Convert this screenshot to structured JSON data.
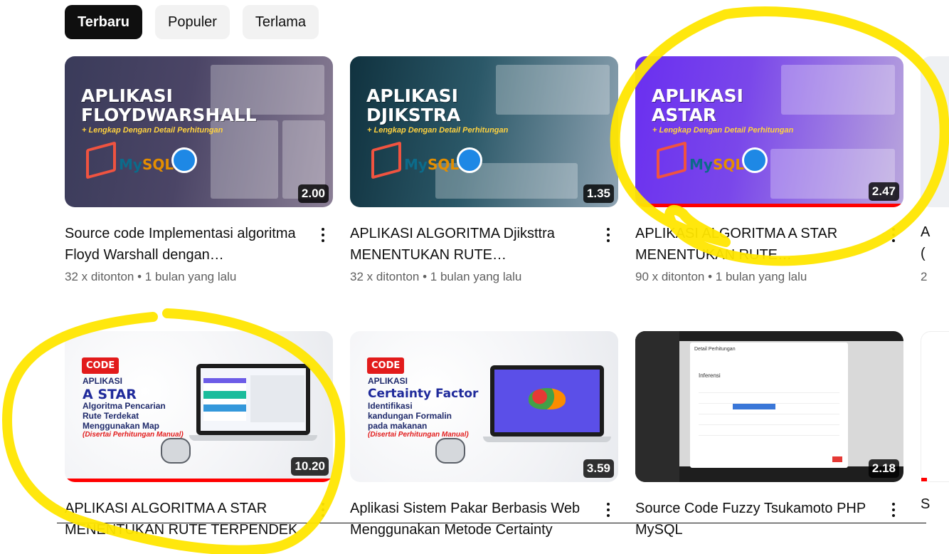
{
  "chips": [
    {
      "label": "Terbaru",
      "active": true
    },
    {
      "label": "Populer",
      "active": false
    },
    {
      "label": "Terlama",
      "active": false
    }
  ],
  "videos": [
    {
      "title": "Source code Implementasi algoritma Floyd Warshall dengan…",
      "views": "32 x ditonton",
      "age": "1 bulan yang lalu",
      "duration": "2.00",
      "thumb_headline": "APLIKASI FLOYDWARSHALL",
      "thumb_sub": "+ Lengkap Dengan Detail Perhitungan",
      "watched_fraction": 0
    },
    {
      "title": "APLIKASI ALGORITMA Djiksttra MENENTUKAN RUTE TERPENDEK…",
      "views": "32 x ditonton",
      "age": "1 bulan yang lalu",
      "duration": "1.35",
      "thumb_headline": "APLIKASI DJIKSTRA",
      "thumb_sub": "+ Lengkap Dengan Detail Perhitungan",
      "watched_fraction": 0
    },
    {
      "title": "APLIKASI ALGORITMA A STAR MENENTUKAN RUTE TERPENDEK…",
      "views": "90 x ditonton",
      "age": "1 bulan yang lalu",
      "duration": "2.47",
      "thumb_headline": "APLIKASI ASTAR",
      "thumb_sub": "+ Lengkap Dengan Detail Perhitungan",
      "watched_fraction": 1
    },
    {
      "title": "APLIKASI ALGORITMA A STAR MENENTUKAN RUTE TERPENDEK",
      "duration": "10.20",
      "thumb_badge": "CODE",
      "thumb_line1": "APLIKASI",
      "thumb_line2": "A STAR",
      "thumb_line3": "Algoritma Pencarian Rute Terdekat Menggunakan Map",
      "thumb_line4": "(Disertai Perhitungan Manual)",
      "watched_fraction": 1
    },
    {
      "title": "Aplikasi Sistem Pakar Berbasis Web Menggunakan Metode Certainty",
      "duration": "3.59",
      "thumb_badge": "CODE",
      "thumb_line1": "APLIKASI",
      "thumb_line2": "Certainty Factor",
      "thumb_line3": "Identifikasi kandungan Formalin pada makanan",
      "thumb_line4": "(Disertai Perhitungan Manual)",
      "watched_fraction": 0
    },
    {
      "title": "Source Code Fuzzy Tsukamoto PHP MySQL",
      "duration": "2.18",
      "thumb_modal_title": "Detail Perhitungan",
      "thumb_modal_section": "Inferensi",
      "watched_fraction": 0
    }
  ],
  "partial_col": {
    "line1": "A",
    "line2": "(",
    "stats": "2",
    "row2_title": "S"
  },
  "colors": {
    "accent_red": "#ff0000",
    "annotation_yellow": "#ffe600",
    "chip_active_bg": "#0f0f0f",
    "chip_bg": "#f2f2f2",
    "meta_gray": "#606060"
  }
}
